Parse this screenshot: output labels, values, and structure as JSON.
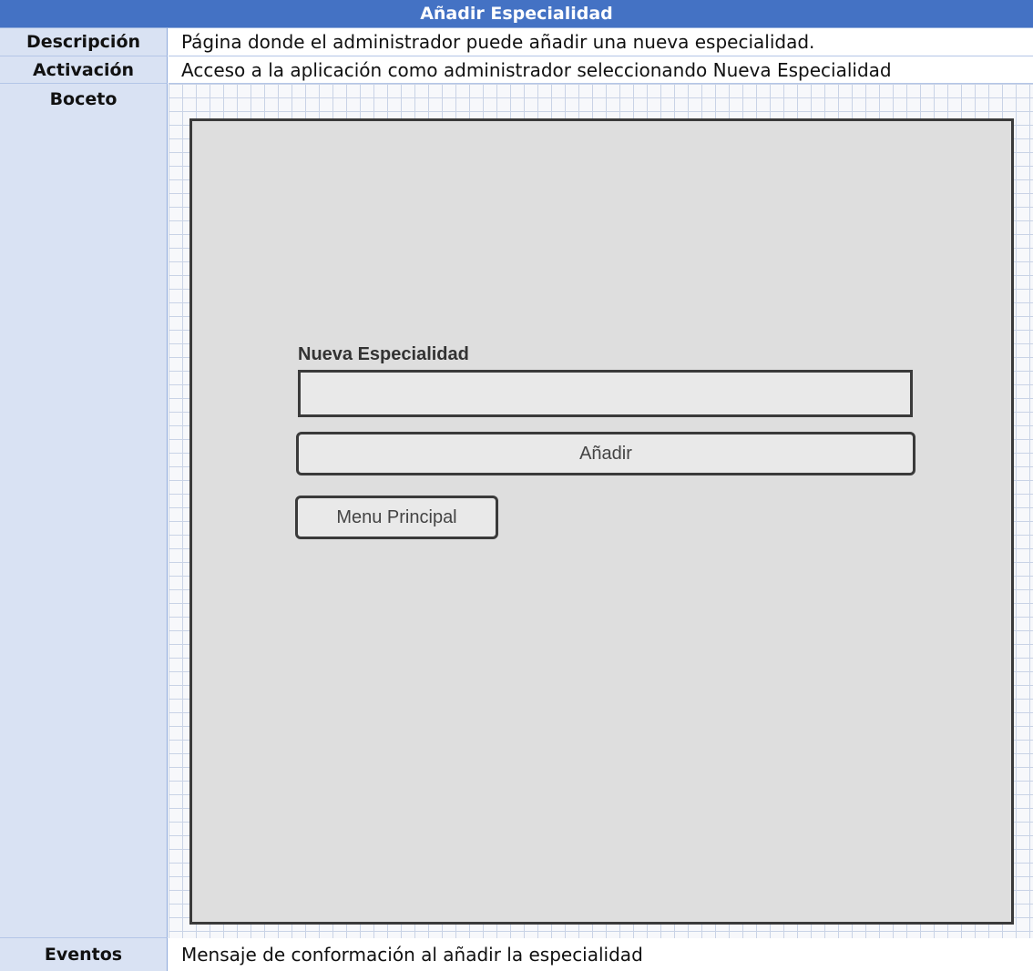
{
  "title": "Añadir Especialidad",
  "rows": {
    "descripcion": {
      "label": "Descripción",
      "value": "Página donde el administrador puede añadir una nueva especialidad."
    },
    "activacion": {
      "label": "Activación",
      "value": "Acceso a la aplicación como administrador seleccionando Nueva Especialidad"
    },
    "boceto": {
      "label": "Boceto"
    },
    "eventos": {
      "label": "Eventos",
      "value": "Mensaje de conformación al añadir la especialidad"
    }
  },
  "mockup": {
    "field_label": "Nueva Especialidad",
    "field_value": "",
    "add_button": "Añadir",
    "menu_button": "Menu Principal"
  }
}
